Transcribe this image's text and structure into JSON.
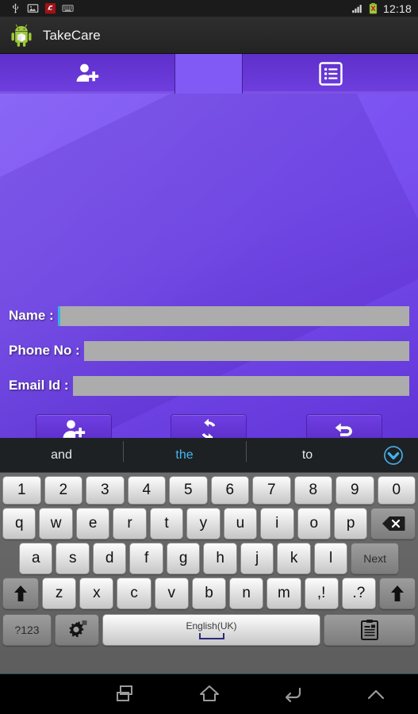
{
  "statusbar": {
    "icons": [
      "usb-icon",
      "gallery-icon",
      "avira-icon",
      "keyboard-icon"
    ],
    "signal_icon": "signal-bars-icon",
    "battery_icon": "battery-warning-icon",
    "clock": "12:18"
  },
  "actionbar": {
    "app_icon": "android-robot-icon",
    "title": "TakeCare"
  },
  "tabs": [
    {
      "name": "tab-add-contact",
      "icon": "add-person-icon",
      "selected": false
    },
    {
      "name": "tab-list-contacts",
      "icon": "list-icon",
      "selected": false
    }
  ],
  "form": {
    "fields": [
      {
        "label": "Name :",
        "value": "",
        "placeholder": "",
        "focused": true
      },
      {
        "label": "Phone No :",
        "value": "",
        "placeholder": "",
        "focused": false
      },
      {
        "label": "Email Id :",
        "value": "",
        "placeholder": "",
        "focused": false
      }
    ],
    "buttons": [
      {
        "name": "add-contact-button",
        "icon": "add-person-icon"
      },
      {
        "name": "refresh-button",
        "icon": "refresh-icon"
      },
      {
        "name": "undo-button",
        "icon": "undo-arrow-icon"
      }
    ]
  },
  "keyboard": {
    "suggestions": [
      {
        "word": "and",
        "active": false
      },
      {
        "word": "the",
        "active": true
      },
      {
        "word": "to",
        "active": false
      }
    ],
    "expand_icon": "chevron-down-circle-icon",
    "rows": {
      "numbers": [
        "1",
        "2",
        "3",
        "4",
        "5",
        "6",
        "7",
        "8",
        "9",
        "0"
      ],
      "top": [
        "q",
        "w",
        "e",
        "r",
        "t",
        "y",
        "u",
        "i",
        "o",
        "p"
      ],
      "home": [
        "a",
        "s",
        "d",
        "f",
        "g",
        "h",
        "j",
        "k",
        "l"
      ],
      "bottom": [
        "z",
        "x",
        "c",
        "v",
        "b",
        "n",
        "m",
        ",!",
        ".?"
      ]
    },
    "backspace_icon": "backspace-icon",
    "next_label": "Next",
    "shift_icon": "shift-arrow-icon",
    "symbols_label": "?123",
    "settings_icon": "gear-icon",
    "space_label": "English(UK)",
    "clipboard_icon": "clipboard-icon"
  },
  "navbar": {
    "buttons": [
      {
        "name": "recents-button",
        "icon": "recents-icon"
      },
      {
        "name": "home-button",
        "icon": "home-icon"
      },
      {
        "name": "back-button",
        "icon": "back-arrow-icon"
      },
      {
        "name": "hide-keyboard-button",
        "icon": "chevron-up-icon"
      }
    ]
  },
  "colors": {
    "purple_light": "#7d55f4",
    "purple_dark": "#6134d6",
    "tab_purple": "#5e2fc9",
    "accent_blue": "#33b5e5",
    "suggest_active": "#46b6f0",
    "field_gray": "#acacac"
  }
}
